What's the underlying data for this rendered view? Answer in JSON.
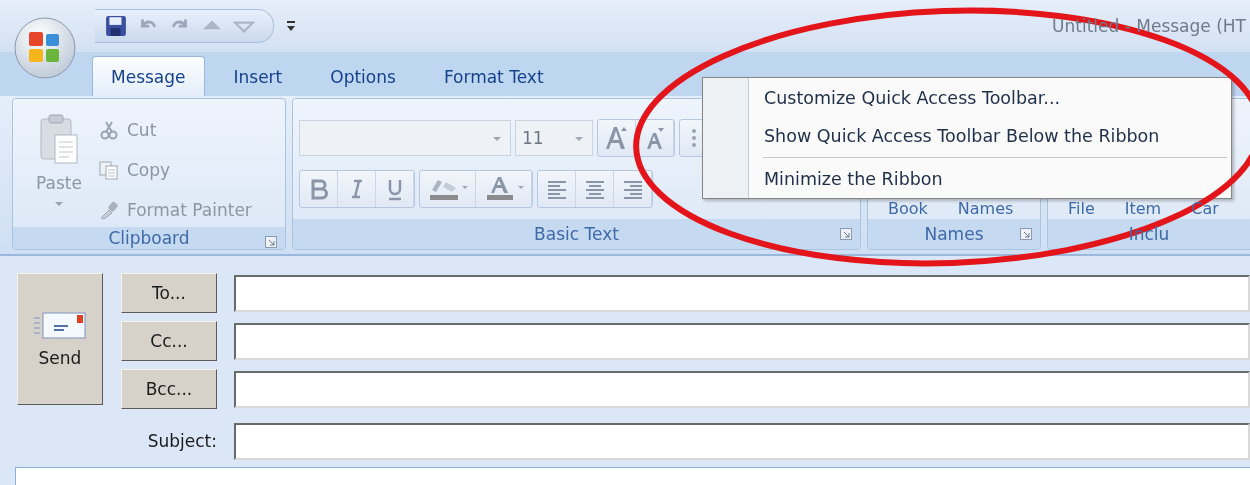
{
  "window": {
    "title": "Untitled - Message (HT"
  },
  "tabs": [
    {
      "label": "Message",
      "selected": true
    },
    {
      "label": "Insert",
      "selected": false
    },
    {
      "label": "Options",
      "selected": false
    },
    {
      "label": "Format Text",
      "selected": false
    }
  ],
  "ribbon": {
    "groups": [
      {
        "kind": "clipboard",
        "label": "Clipboard",
        "paste": "Paste",
        "items": [
          {
            "label": "Cut",
            "disabled": true
          },
          {
            "label": "Copy",
            "disabled": true
          },
          {
            "label": "Format Painter",
            "disabled": true
          }
        ]
      },
      {
        "kind": "basic_text",
        "label": "Basic Text",
        "font_size": "11"
      },
      {
        "kind": "names",
        "label": "Names",
        "buttons": [
          "Book",
          "Names"
        ]
      },
      {
        "kind": "include",
        "label": "Inclu",
        "buttons": [
          "File",
          "Item",
          "Car"
        ]
      }
    ]
  },
  "context_menu": {
    "items": [
      {
        "label": "Customize Quick Access Toolbar...",
        "separator_after": false
      },
      {
        "label": "Show Quick Access Toolbar Below the Ribbon",
        "separator_after": true
      },
      {
        "label": "Minimize the Ribbon",
        "separator_after": false
      }
    ]
  },
  "compose": {
    "send": "Send",
    "recipients": [
      {
        "button": "To..."
      },
      {
        "button": "Cc..."
      },
      {
        "button": "Bcc..."
      }
    ],
    "subject_label": "Subject:"
  }
}
